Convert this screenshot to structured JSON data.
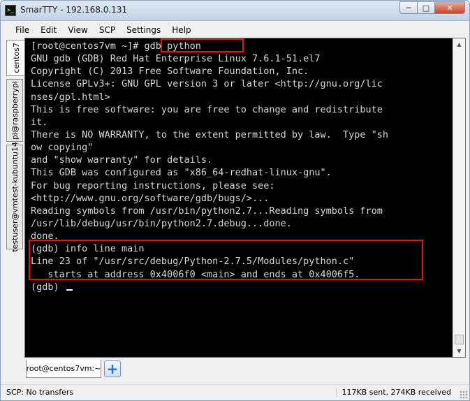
{
  "window": {
    "title": "SmarTTY - 192.168.0.131",
    "app_icon": "terminal-icon",
    "close_glyph": "✕",
    "maximize_glyph": "□",
    "minimize_glyph": "─"
  },
  "menu": [
    "File",
    "Edit",
    "View",
    "SCP",
    "Settings",
    "Help"
  ],
  "side_tabs": [
    "centos7",
    "pi@raspberrypi",
    "testuser@vmtest-kubuntu14"
  ],
  "terminal": {
    "lines": [
      "[root@centos7vm ~]# gdb python",
      "GNU gdb (GDB) Red Hat Enterprise Linux 7.6.1-51.el7",
      "Copyright (C) 2013 Free Software Foundation, Inc.",
      "License GPLv3+: GNU GPL version 3 or later <http://gnu.org/lic",
      "nses/gpl.html>",
      "This is free software: you are free to change and redistribute",
      "it.",
      "There is NO WARRANTY, to the extent permitted by law.  Type \"sh",
      "ow copying\"",
      "and \"show warranty\" for details.",
      "This GDB was configured as \"x86_64-redhat-linux-gnu\".",
      "For bug reporting instructions, please see:",
      "<http://www.gnu.org/software/gdb/bugs/>...",
      "Reading symbols from /usr/bin/python2.7...Reading symbols from",
      "/usr/lib/debug/usr/bin/python2.7.debug...done.",
      "done.",
      "(gdb) info line main",
      "Line 23 of \"/usr/src/debug/Python-2.7.5/Modules/python.c\"",
      "   starts at address 0x4006f0 <main> and ends at 0x4006f5.",
      "(gdb) "
    ]
  },
  "bottom_tabs": {
    "active": "root@centos7vm:~",
    "add_icon": "plus-icon"
  },
  "status": {
    "left": "SCP: No transfers",
    "right": "117KB sent, 274KB received"
  },
  "colors": {
    "terminal_bg": "#000000",
    "terminal_fg": "#d8d8d8",
    "highlight": "#e1141a"
  }
}
